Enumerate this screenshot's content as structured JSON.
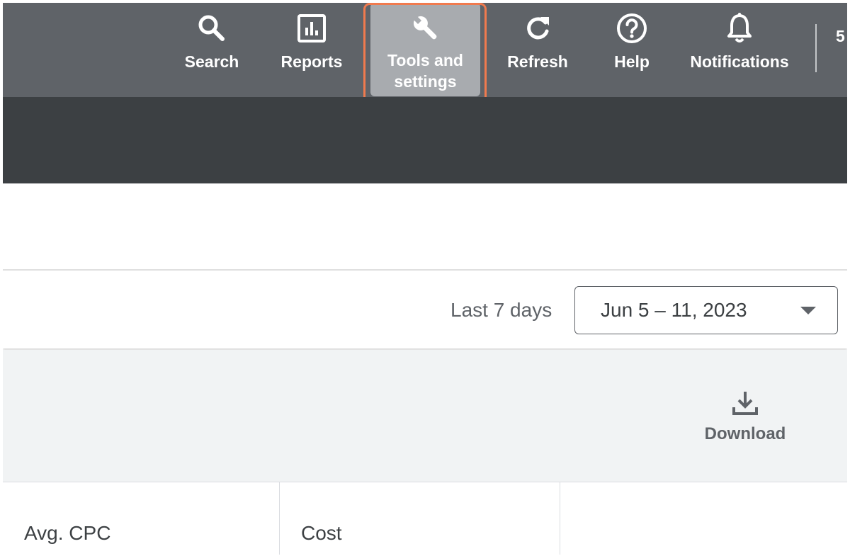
{
  "toolbar": {
    "items": [
      {
        "label": "Search",
        "icon": "search-icon"
      },
      {
        "label": "Reports",
        "icon": "bar-chart-icon"
      },
      {
        "label_line1": "Tools and",
        "label_line2": "settings",
        "icon": "wrench-icon"
      },
      {
        "label": "Refresh",
        "icon": "refresh-icon"
      },
      {
        "label": "Help",
        "icon": "help-icon"
      },
      {
        "label": "Notifications",
        "icon": "bell-icon"
      }
    ],
    "account_peek": "5"
  },
  "date_filter": {
    "preset": "Last 7 days",
    "range": "Jun 5 – 11, 2023"
  },
  "actions": {
    "download_label": "Download",
    "download_icon": "download-icon"
  },
  "table": {
    "columns": [
      "Avg. CPC",
      "Cost",
      ""
    ]
  },
  "colors": {
    "toolbar_bg": "#5f6368",
    "dark_band": "#3c4043",
    "active_tool_bg": "#a8abaf",
    "highlight": "#f07a4e",
    "grey_area": "#f1f3f4"
  }
}
